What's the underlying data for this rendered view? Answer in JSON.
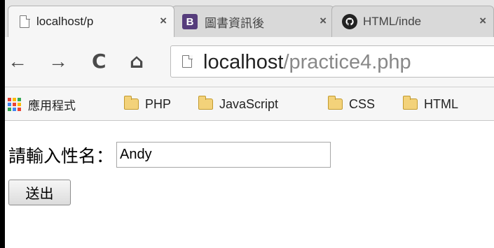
{
  "browser": {
    "tabs": [
      {
        "title": "localhost/p",
        "icon": "page-icon",
        "active": true
      },
      {
        "title": "圖書資訊後",
        "icon": "bootstrap-icon",
        "icon_letter": "B",
        "active": false
      },
      {
        "title": "HTML/inde",
        "icon": "github-icon",
        "active": false
      }
    ],
    "tab_close_glyph": "×",
    "toolbar": {
      "back": "←",
      "forward": "→",
      "reload": "C",
      "home": "⌂"
    },
    "url": {
      "host": "localhost",
      "path": "/practice4.php"
    },
    "bookmarks": [
      {
        "label": "應用程式",
        "icon": "apps-icon"
      },
      {
        "label": "PHP",
        "icon": "folder-icon"
      },
      {
        "label": "JavaScript",
        "icon": "folder-icon"
      },
      {
        "label": "CSS",
        "icon": "folder-icon"
      },
      {
        "label": "HTML",
        "icon": "folder-icon"
      }
    ]
  },
  "form": {
    "name_label": "請輸入性名：",
    "name_value": "Andy",
    "submit_label": "送出"
  },
  "colors": {
    "apps_grid": [
      "#ea4335",
      "#fbbc05",
      "#34a853",
      "#4285f4",
      "#ea4335",
      "#fbbc05",
      "#34a853",
      "#4285f4",
      "#ea4335"
    ],
    "bootstrap": "#563d7c",
    "folder": "#f3d27a"
  }
}
